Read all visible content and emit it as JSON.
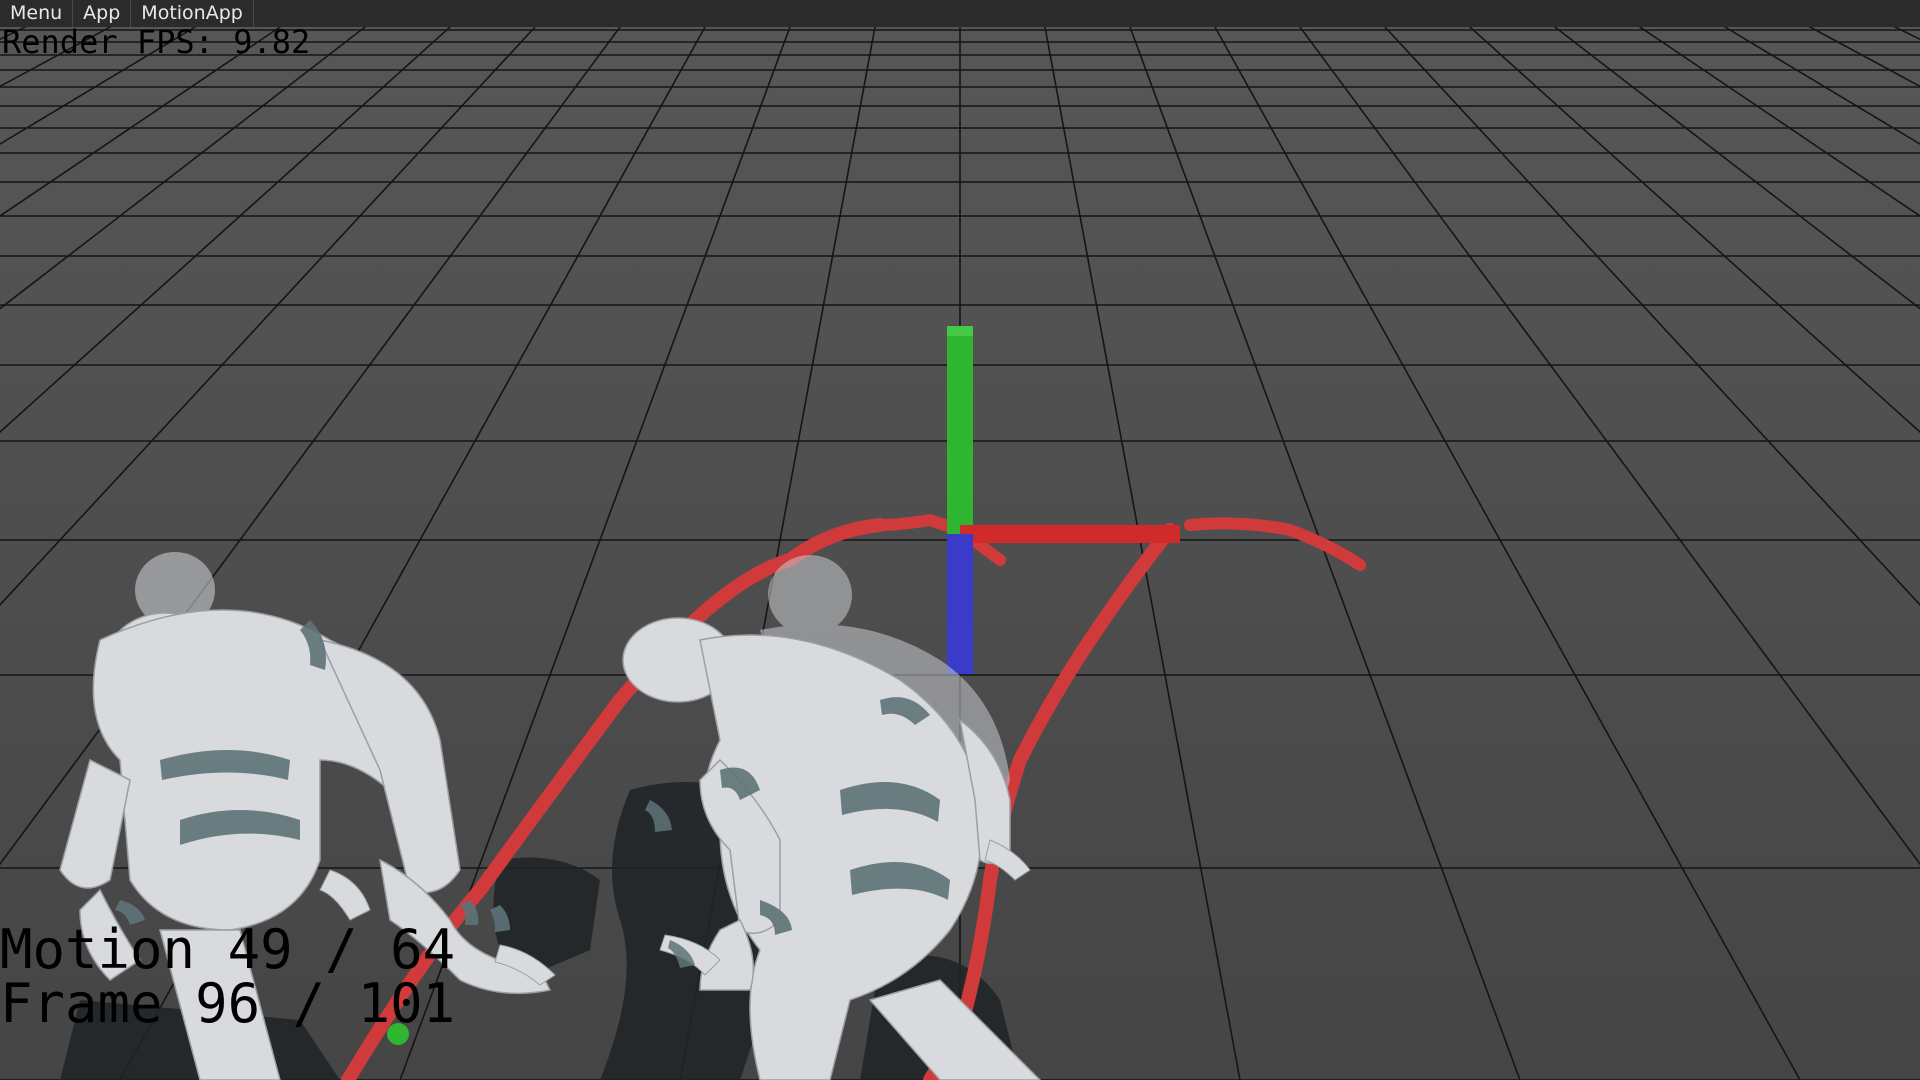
{
  "menubar": {
    "items": [
      {
        "label": "Menu"
      },
      {
        "label": "App"
      },
      {
        "label": "MotionApp"
      }
    ]
  },
  "overlay": {
    "fps": "Render FPS: 9.82",
    "motion": "Motion 49 / 64",
    "frame": "Frame 96 / 101"
  },
  "scene": {
    "floor_color": "#4a4a4a",
    "grid_color": "#111111",
    "trajectory_color": "#d13a3a",
    "current_marker_color": "#2fb52f",
    "axis_colors": {
      "x": "#d02a2a",
      "y": "#2fb52f",
      "z": "#3a3acb"
    },
    "character_color": "#d8dade",
    "character_joint_color": "#5e7378",
    "shadow_color": "#1f2326"
  }
}
